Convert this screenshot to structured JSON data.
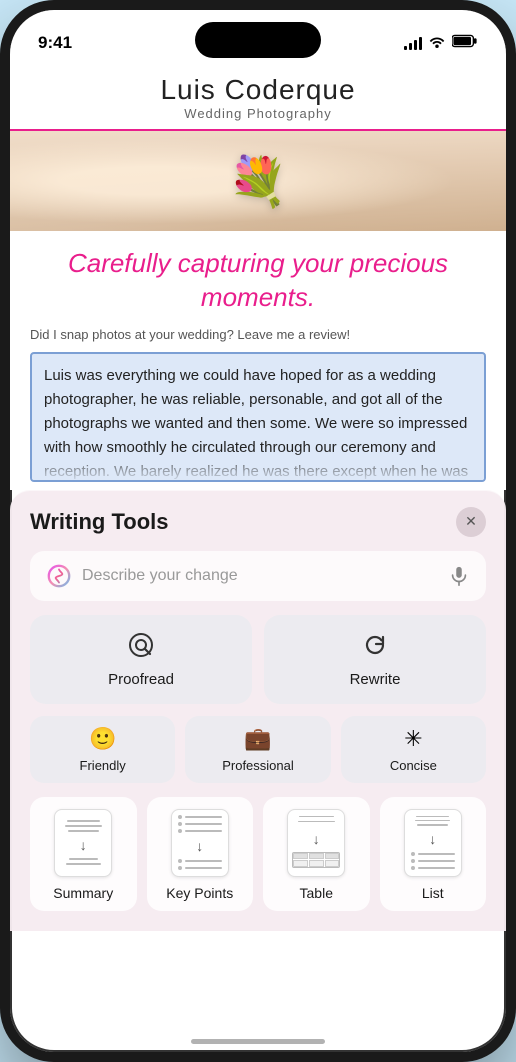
{
  "status_bar": {
    "time": "9:41"
  },
  "site": {
    "title": "Luis Coderque",
    "subtitle": "Wedding Photography",
    "tagline": "Carefully capturing your precious moments.",
    "review_prompt": "Did I snap photos at your wedding? Leave me a review!"
  },
  "selected_text": "Luis was everything we could have hoped for as a wedding photographer, he was reliable, personable, and got all of the photographs we wanted and then some. We were so impressed with how smoothly he circulated through our ceremony and reception. We barely realized he was there except when he was very",
  "writing_tools": {
    "title": "Writing Tools",
    "search_placeholder": "Describe your change",
    "buttons": {
      "proofread": "Proofread",
      "rewrite": "Rewrite",
      "friendly": "Friendly",
      "professional": "Professional",
      "concise": "Concise",
      "summary": "Summary",
      "key_points": "Key Points",
      "table": "Table",
      "list": "List"
    }
  }
}
